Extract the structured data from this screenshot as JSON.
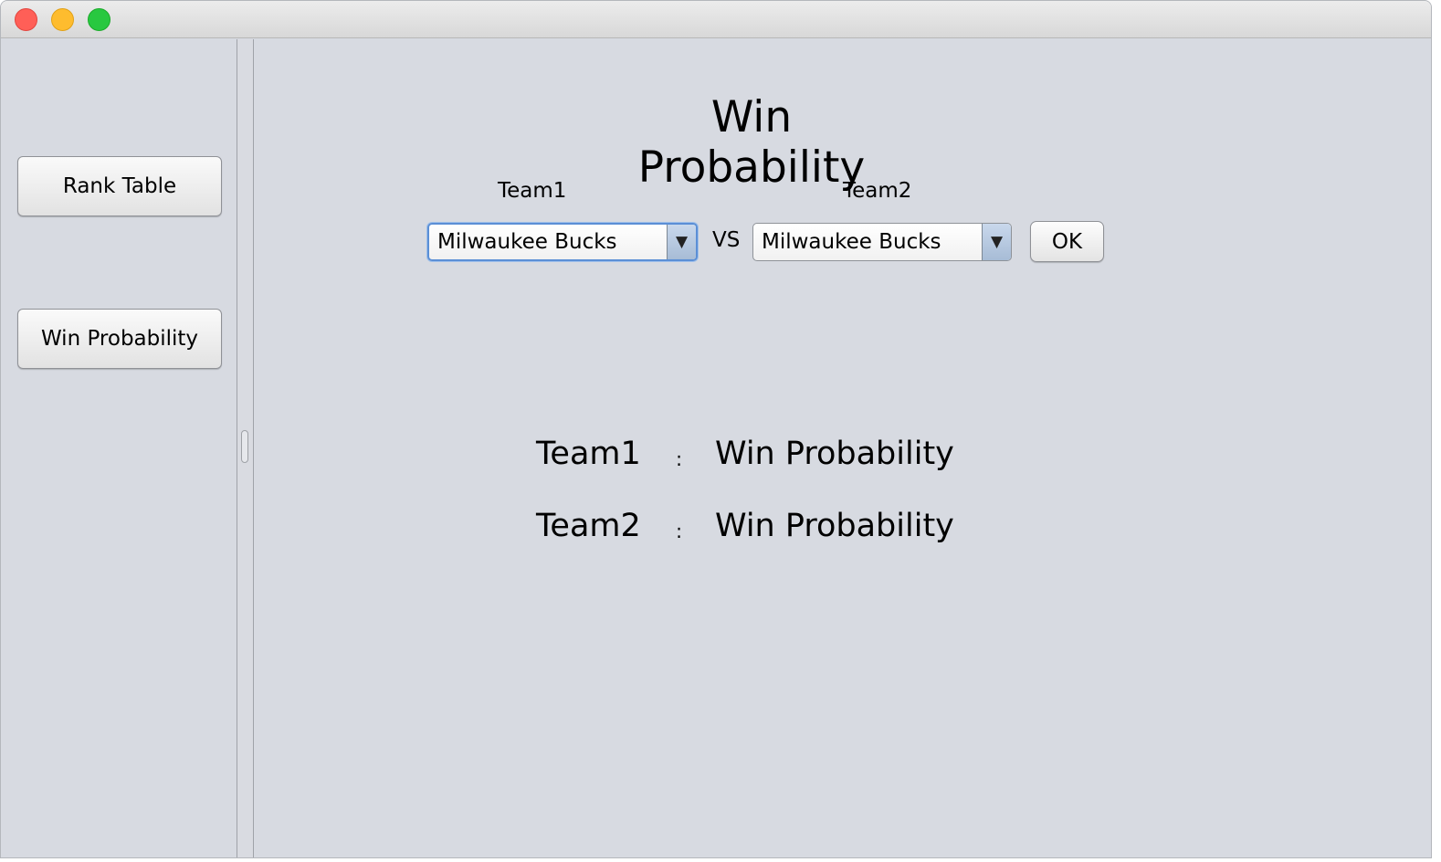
{
  "sidebar": {
    "buttons": [
      "Rank Table",
      "Win Probability"
    ]
  },
  "main": {
    "title": "Win Probability",
    "team1_label": "Team1",
    "team2_label": "Team2",
    "team1_select": "Milwaukee Bucks",
    "team2_select": "Milwaukee Bucks",
    "vs_label": "VS",
    "ok_label": "OK",
    "results": [
      {
        "team": "Team1",
        "separator": ":",
        "probability": "Win Probability"
      },
      {
        "team": "Team2",
        "separator": ":",
        "probability": "Win Probability"
      }
    ]
  },
  "icons": {
    "dropdown": "chevron-down-icon",
    "window_controls": [
      "close-icon",
      "minimize-icon",
      "maximize-icon"
    ]
  },
  "colors": {
    "focus_ring": "#5b8fd6",
    "window_bg": "#d7dae1",
    "close": "#ff5f57",
    "minimize": "#febc2e",
    "maximize": "#28c840"
  }
}
